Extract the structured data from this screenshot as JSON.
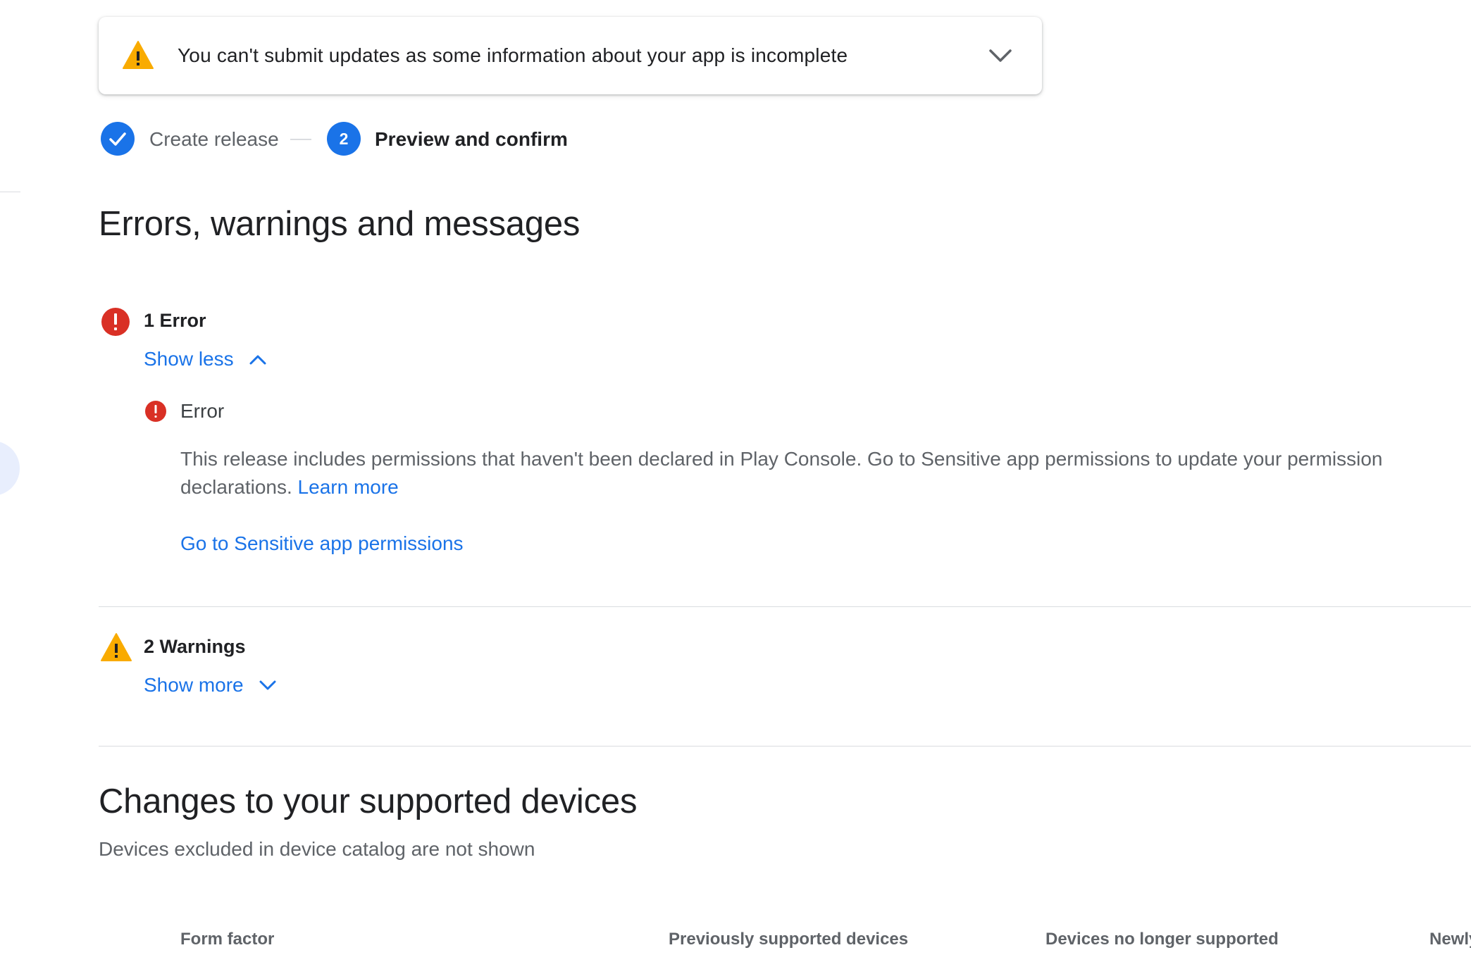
{
  "banner": {
    "message": "You can't submit updates as some information about your app is incomplete",
    "icon": "warning-icon",
    "expand_icon": "chevron-down-icon"
  },
  "stepper": {
    "steps": [
      {
        "label": "Create release",
        "status": "completed",
        "icon": "check-icon"
      },
      {
        "label": "Preview and confirm",
        "status": "current",
        "number": "2"
      }
    ]
  },
  "errors_section": {
    "title": "Errors, warnings and messages",
    "errors": {
      "title": "1 Error",
      "toggle_label": "Show less",
      "toggle_icon": "chevron-up-icon",
      "items": [
        {
          "label": "Error",
          "body": "This release includes permissions that haven't been declared in Play Console. Go to Sensitive app permissions to update your permission declarations.",
          "learn_more": "Learn more",
          "action": "Go to Sensitive app permissions"
        }
      ]
    },
    "warnings": {
      "title": "2 Warnings",
      "toggle_label": "Show more",
      "toggle_icon": "chevron-down-icon"
    }
  },
  "devices_section": {
    "title": "Changes to your supported devices",
    "subtitle": "Devices excluded in device catalog are not shown",
    "columns": [
      "Form factor",
      "Previously supported devices",
      "Devices no longer supported",
      "Newly"
    ]
  },
  "colors": {
    "accent": "#1a73e8",
    "error": "#d93025",
    "warning": "#f9ab00"
  }
}
